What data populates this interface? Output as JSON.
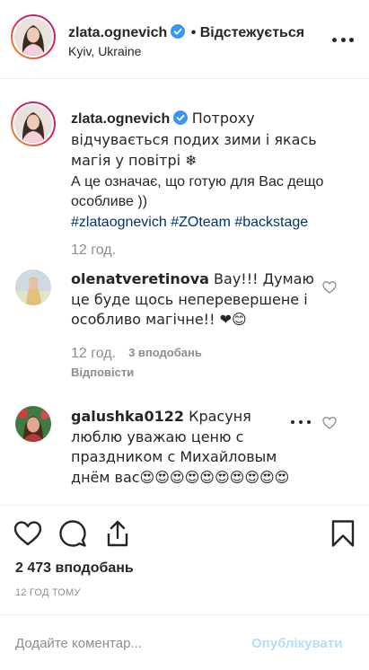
{
  "header": {
    "username": "zlata.ognevich",
    "follow_status": "• Відстежується",
    "location": "Kyiv, Ukraine"
  },
  "caption": {
    "username": "zlata.ognevich",
    "text_line1": "Потроху відчувається подих зими і якась магія у повітрі ❄",
    "text_line2": "А це означає, що готую для Вас дещо особливе ))",
    "hashtags": [
      "#zlataognevich",
      "#ZOteam",
      "#backstage"
    ],
    "time": "12 год."
  },
  "comments": [
    {
      "username": "olenatveretinova",
      "text": "Вау!!! Думаю це буде щось неперевершене і особливо магічне!! ❤😊",
      "time": "12 год.",
      "likes": "3 вподобань",
      "reply": "Відповісти"
    },
    {
      "username": "galushka0122",
      "text": "Красуня люблю уважаю ценю с праздником с Михайловым днём вас😍😍😍😍😍😍😍😍😍😍",
      "time": "",
      "likes": "",
      "reply": ""
    }
  ],
  "footer": {
    "likes_total": "2 473 вподобань",
    "posted_ago": "12 ГОД ТОМУ",
    "comment_placeholder": "Додайте коментар...",
    "publish_label": "Опублікувати"
  },
  "icons": {
    "more": "more-options-icon",
    "verified": "verified-badge-icon",
    "like": "heart-icon",
    "comment": "comment-bubble-icon",
    "share": "share-icon",
    "save": "bookmark-icon"
  },
  "colors": {
    "verified": "#3897f0",
    "hashtag": "#003569",
    "muted": "#8e8e8e",
    "publish_disabled": "#b2dffc"
  }
}
